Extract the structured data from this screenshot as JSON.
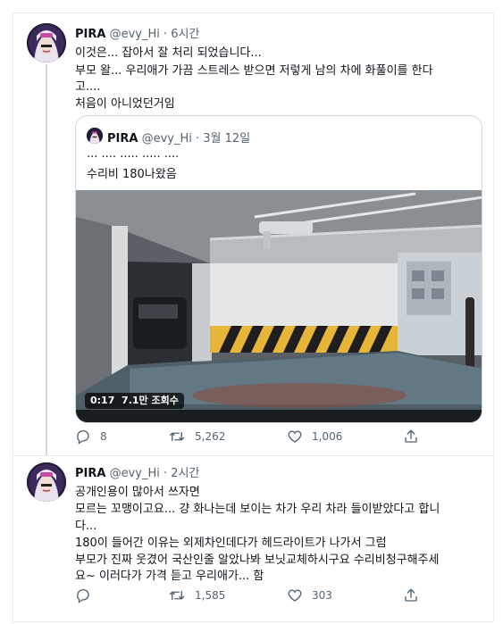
{
  "tweets": [
    {
      "name": "PIRA",
      "handle": "@evy_Hi",
      "sep": "·",
      "time": "6시간",
      "lines": [
        "이것은... 잡아서 잘 처리 되었습니다...",
        "부모 왈... 우리애가 가끔 스트레스 받으면 저렇게 남의 차에 화풀이를 한다",
        "고....",
        "처음이 아니었던거임"
      ],
      "quote": {
        "name": "PIRA",
        "handle": "@evy_Hi",
        "sep": "·",
        "date": "3월 12일",
        "lines": [
          "... .... ..... ..... ....",
          "수리비 180나왔음"
        ],
        "video": {
          "duration": "0:17",
          "views": "7.1만 조회수"
        }
      },
      "actions": {
        "replies": "8",
        "retweets": "5,262",
        "likes": "1,006"
      }
    },
    {
      "name": "PIRA",
      "handle": "@evy_Hi",
      "sep": "·",
      "time": "2시간",
      "lines": [
        "공개인용이 많아서 쓰자면",
        "모르는 꼬맹이고요... 걍 화나는데 보이는 차가 우리 차라 들이받았다고 합니",
        "다...",
        "180이 들어간 이유는 외제차인데다가 헤드라이트가 나가서 그럼",
        "부모가 진짜 웃겼어 국산인줄 알았나봐 보닛교체하시구요 수리비청구해주세",
        "요~ 이러다가 가격 듣고 우리애가... 함"
      ],
      "actions": {
        "replies": "",
        "retweets": "1,585",
        "likes": "303"
      }
    }
  ],
  "icons": {
    "reply": "reply-icon",
    "retweet": "retweet-icon",
    "like": "heart-icon",
    "share": "share-icon"
  },
  "colors": {
    "text": "#0f1419",
    "muted": "#536471",
    "border": "#cfd9de",
    "divider": "#e6ecf0"
  }
}
